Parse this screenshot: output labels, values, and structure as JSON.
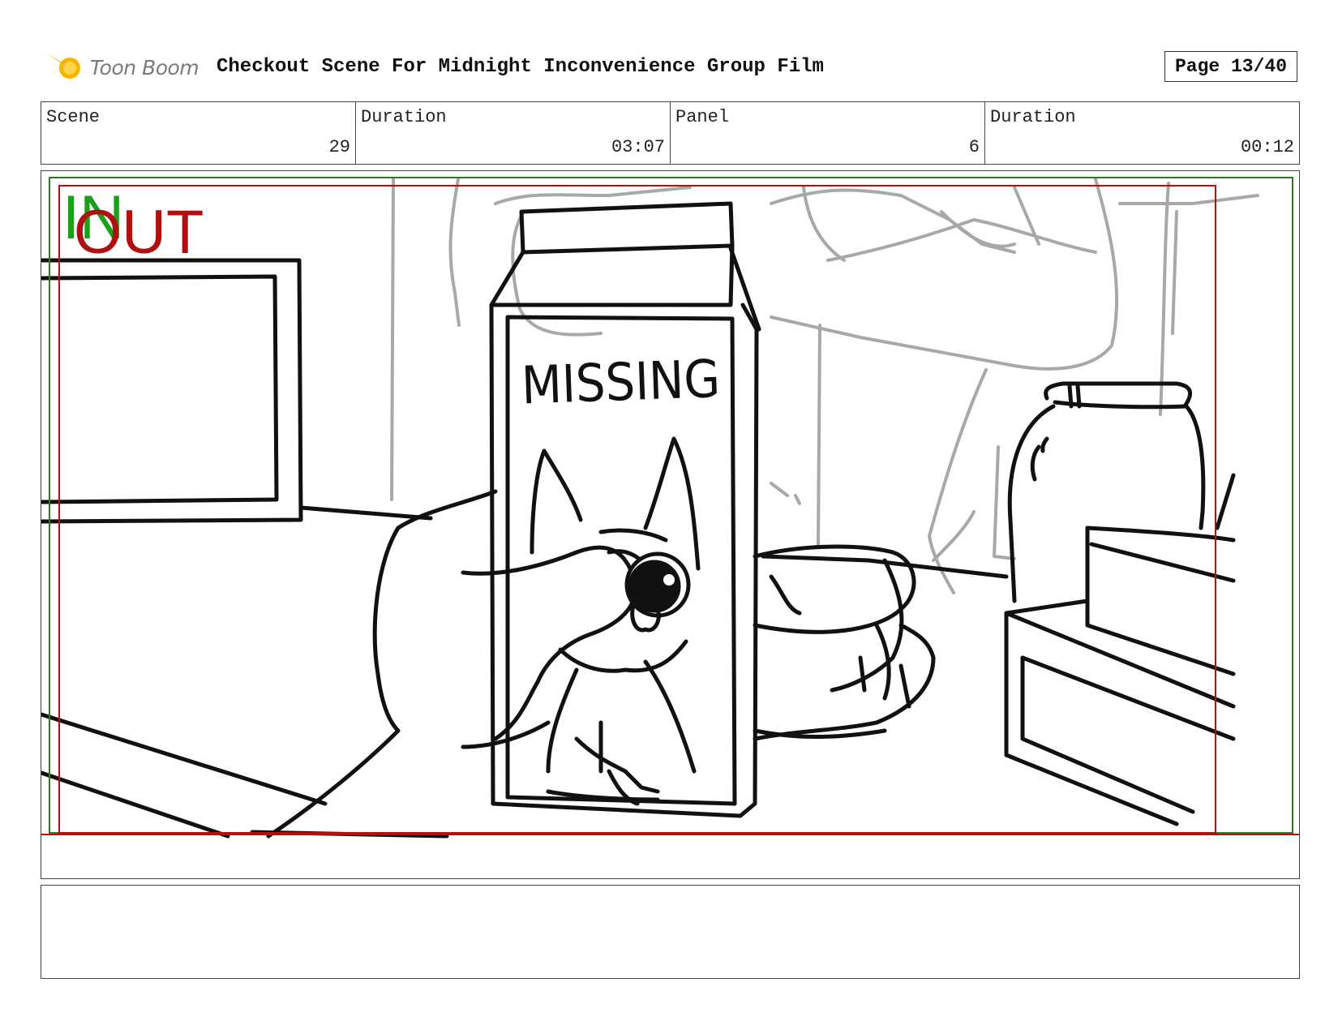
{
  "header": {
    "logo_text": "Toon Boom",
    "title": "Checkout Scene For Midnight Inconvenience Group Film",
    "page": "Page 13/40"
  },
  "info": {
    "scene_label": "Scene",
    "scene_value": "29",
    "scene_duration_label": "Duration",
    "scene_duration_value": "03:07",
    "panel_label": "Panel",
    "panel_value": "6",
    "panel_duration_label": "Duration",
    "panel_duration_value": "00:12"
  },
  "panel": {
    "in_marker": "IN",
    "out_marker": "OUT",
    "carton_text": "MISSING"
  },
  "colors": {
    "in_marker": "#1aa01a",
    "out_marker": "#b01010",
    "sketch_ink": "#111111",
    "background_sketch": "#a8a8a8"
  },
  "notes": {
    "text": ""
  }
}
